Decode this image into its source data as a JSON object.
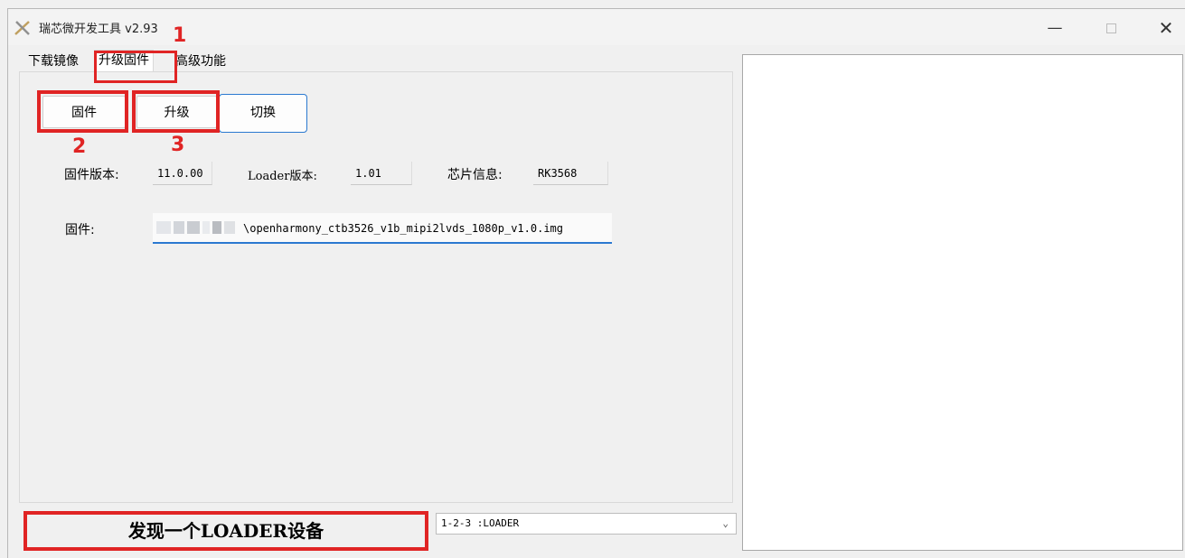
{
  "window": {
    "title": "瑞芯微开发工具 v2.93",
    "controls": {
      "minimize": "—",
      "maximize": "□",
      "close": "✕"
    }
  },
  "tabs": [
    {
      "label": "下载镜像"
    },
    {
      "label": "升级固件",
      "active": true
    },
    {
      "label": "高级功能"
    }
  ],
  "buttons": {
    "firmware": "固件",
    "upgrade": "升级",
    "switch": "切换"
  },
  "annotations": {
    "n1": "1",
    "n2": "2",
    "n3": "3"
  },
  "info": {
    "firmware_version_label": "固件版本:",
    "firmware_version_value": "11.0.00",
    "loader_version_label": "Loader版本:",
    "loader_version_value": "1.01",
    "chip_label": "芯片信息:",
    "chip_value": "RK3568"
  },
  "firmware_path": {
    "label": "固件:",
    "value": "\\openharmony_ctb3526_v1b_mipi2lvds_1080p_v1.0.img"
  },
  "status": {
    "message": "发现一个LOADER设备",
    "device_select": "1-2-3 :LOADER"
  },
  "colors": {
    "annotation_red": "#e02424",
    "accent_blue": "#2b79d0"
  }
}
